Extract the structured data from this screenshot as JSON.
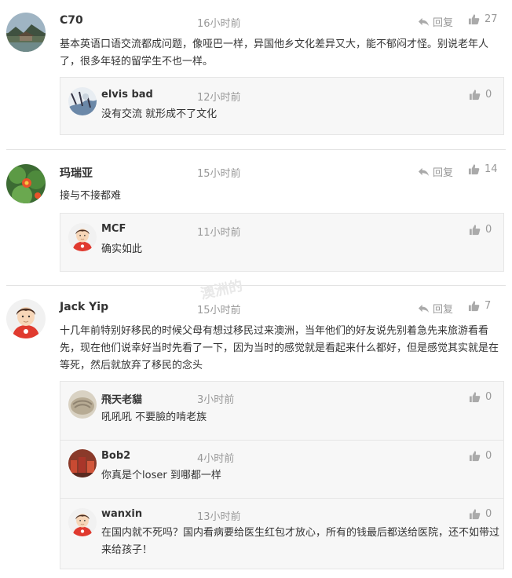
{
  "comments": [
    {
      "user": "C70",
      "time": "16小时前",
      "reply_label": "回复",
      "likes": "27",
      "text": "基本英语口语交流都成问题，像哑巴一样，异国他乡文化差异又大，能不郁闷才怪。别说老年人了，很多年轻的留学生不也一样。",
      "replies": [
        {
          "user": "elvis bad",
          "time": "12小时前",
          "likes": "0",
          "text": "没有交流 就形成不了文化"
        }
      ]
    },
    {
      "user": "玛瑞亚",
      "time": "15小时前",
      "reply_label": "回复",
      "likes": "14",
      "text": "接与不接都难",
      "replies": [
        {
          "user": "MCF",
          "time": "11小时前",
          "likes": "0",
          "text": "确实如此"
        }
      ]
    },
    {
      "user": "Jack Yip",
      "time": "15小时前",
      "reply_label": "回复",
      "likes": "7",
      "text": "十几年前特别好移民的时候父母有想过移民过来澳洲，当年他们的好友说先别着急先来旅游看看先，现在他们说幸好当时先看了一下，因为当时的感觉就是看起来什么都好，但是感觉其实就是在等死，然后就放弃了移民的念头",
      "replies": [
        {
          "user": "飛天老貓",
          "time": "3小时前",
          "likes": "0",
          "text": "吼吼吼 不要臉的啃老族"
        },
        {
          "user": "Bob2",
          "time": "4小时前",
          "likes": "0",
          "text": "你真是个loser 到哪都一样"
        },
        {
          "user": "wanxin",
          "time": "13小时前",
          "likes": "0",
          "text": "在国内就不死吗？国内看病要给医生红包才放心，所有的钱最后都送给医院，还不如带过来给孩子！"
        }
      ]
    }
  ],
  "watermark": "澳洲的",
  "colors": {
    "meta": "#999999",
    "text": "#333333",
    "reply_bg": "#f7f7f7",
    "border": "#e6e6e6"
  },
  "icons": {
    "reply": "reply-arrow-icon",
    "like": "thumbs-up-icon"
  }
}
